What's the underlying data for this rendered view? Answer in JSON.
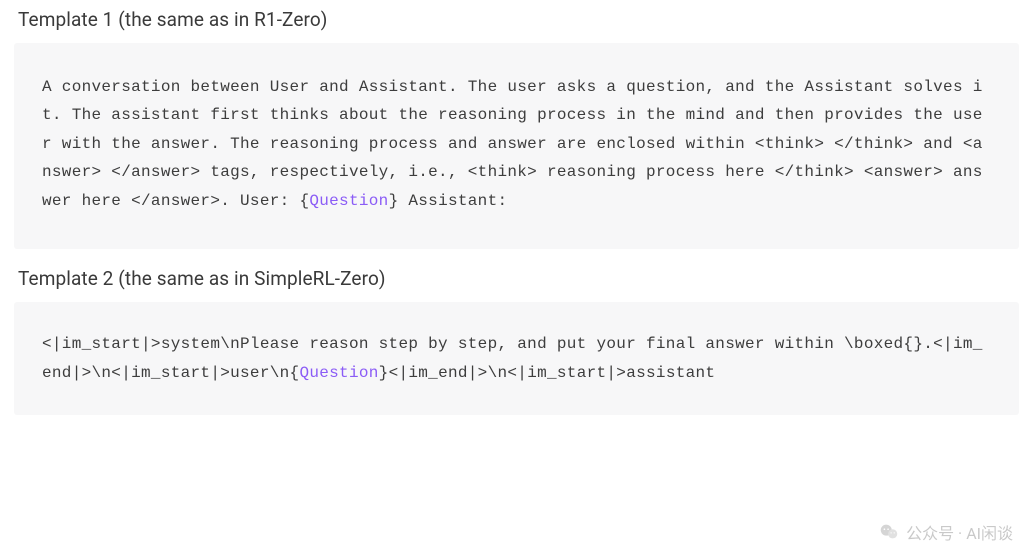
{
  "template1": {
    "heading": "Template 1 (the same as in R1-Zero)",
    "code_pre": "A conversation between User and Assistant. The user asks a question, and the Assistant solves it. The assistant first thinks about the reasoning process in the mind and then provides the user with the answer. The reasoning process and answer are enclosed within <think> </think> and <answer> </answer> tags, respectively, i.e., <think> reasoning process here </think> <answer> answer here </answer>. User: {",
    "question_token": "Question",
    "code_post": "} Assistant:"
  },
  "template2": {
    "heading": "Template 2 (the same as in SimpleRL-Zero)",
    "code_pre": "<|im_start|>system\\nPlease reason step by step, and put your final answer within \\boxed{}.<|im_end|>\\n<|im_start|>user\\n{",
    "question_token": "Question",
    "code_post": "}<|im_end|>\\n<|im_start|>assistant"
  },
  "watermark": {
    "text": "公众号 · AI闲谈"
  }
}
